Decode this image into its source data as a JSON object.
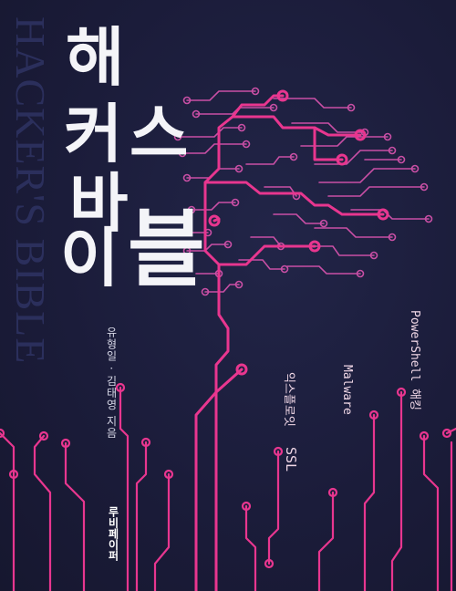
{
  "cover": {
    "background_title": "HACKER'S BIBLE",
    "title_chars": [
      "해",
      "커",
      "스",
      "바",
      "이",
      "블"
    ],
    "topics": {
      "ssl": "SSL",
      "exploit": "익스플로잇",
      "malware": "Malware",
      "powershell": "PowerShell 해킹"
    },
    "authors": "유형일 · 김태영 지음",
    "publisher": "루비페이퍼"
  },
  "colors": {
    "background": "#1b1c3a",
    "circuit": "#e8368f",
    "circuit_light": "#c94fa5",
    "title": "#f4f4f8",
    "background_text": "#2b2f5c"
  }
}
